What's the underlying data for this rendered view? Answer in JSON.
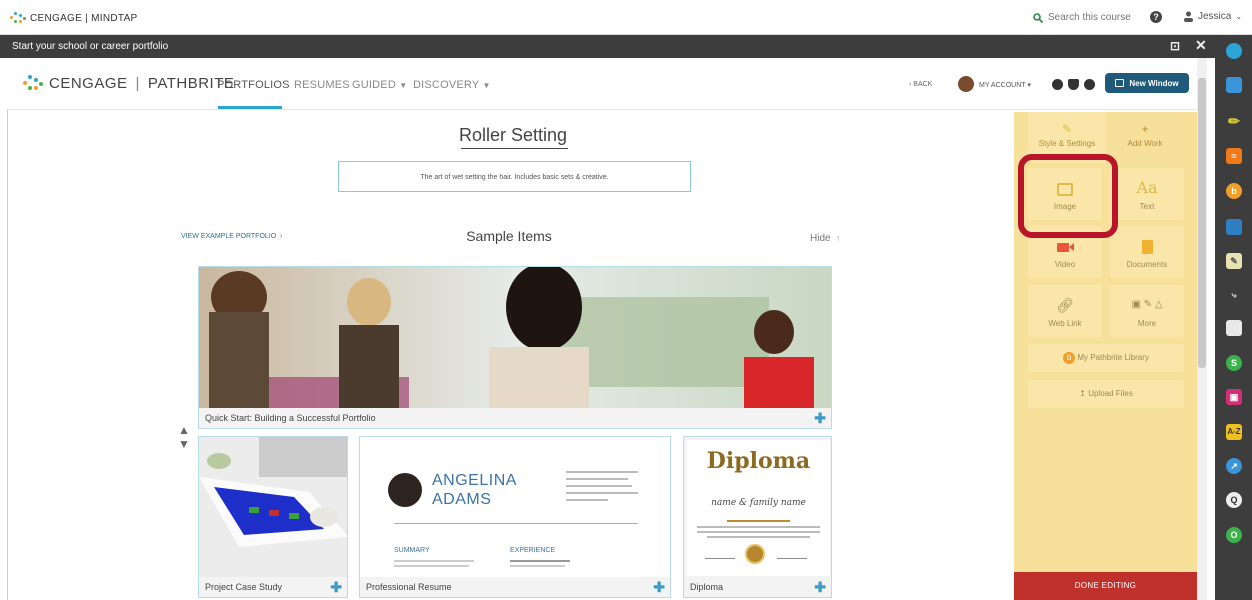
{
  "mindtap": {
    "brand": "CENGAGE | MINDTAP",
    "search_label": "Search this course",
    "user_name": "Jessica"
  },
  "activity": {
    "title": "Start your school or career portfolio"
  },
  "pathbrite": {
    "logo_left": "CENGAGE",
    "logo_right": "PATHBRITE",
    "nav": {
      "portfolios": "PORTFOLIOS",
      "resumes": "RESUMES",
      "guided": "GUIDED",
      "discovery": "DISCOVERY"
    },
    "back": "BACK",
    "my_account": "MY ACCOUNT",
    "new_window": "New Window"
  },
  "portfolio": {
    "title": "Roller Setting",
    "description": "The art of wet setting the hair. Includes basic sets & creative.",
    "view_example": "VIEW EXAMPLE PORTFOLIO",
    "sample_items": "Sample Items",
    "hide": "Hide"
  },
  "cards": {
    "quick_start": "Quick Start: Building a Successful Portfolio",
    "project_case": "Project Case Study",
    "resume": "Professional Resume",
    "diploma": "Diploma"
  },
  "resume_doc": {
    "first": "ANGELINA",
    "last": "ADAMS",
    "summary": "SUMMARY",
    "experience": "EXPERIENCE"
  },
  "diploma_doc": {
    "heading": "Diploma",
    "subtitle": "name & family name"
  },
  "panel": {
    "style_settings": "Style & Settings",
    "add_work": "Add Work",
    "image": "Image",
    "text": "Text",
    "text_glyph": "Aa",
    "video": "Video",
    "documents": "Documents",
    "web_link": "Web Link",
    "more": "More",
    "library": "My Pathbrite Library",
    "upload": "Upload Files",
    "done": "DONE EDITING"
  },
  "colors": {
    "accent_blue": "#2aa5d6",
    "panel_yellow": "#f7e09a",
    "highlight_red": "#b8152b",
    "done_red": "#c0312b"
  }
}
